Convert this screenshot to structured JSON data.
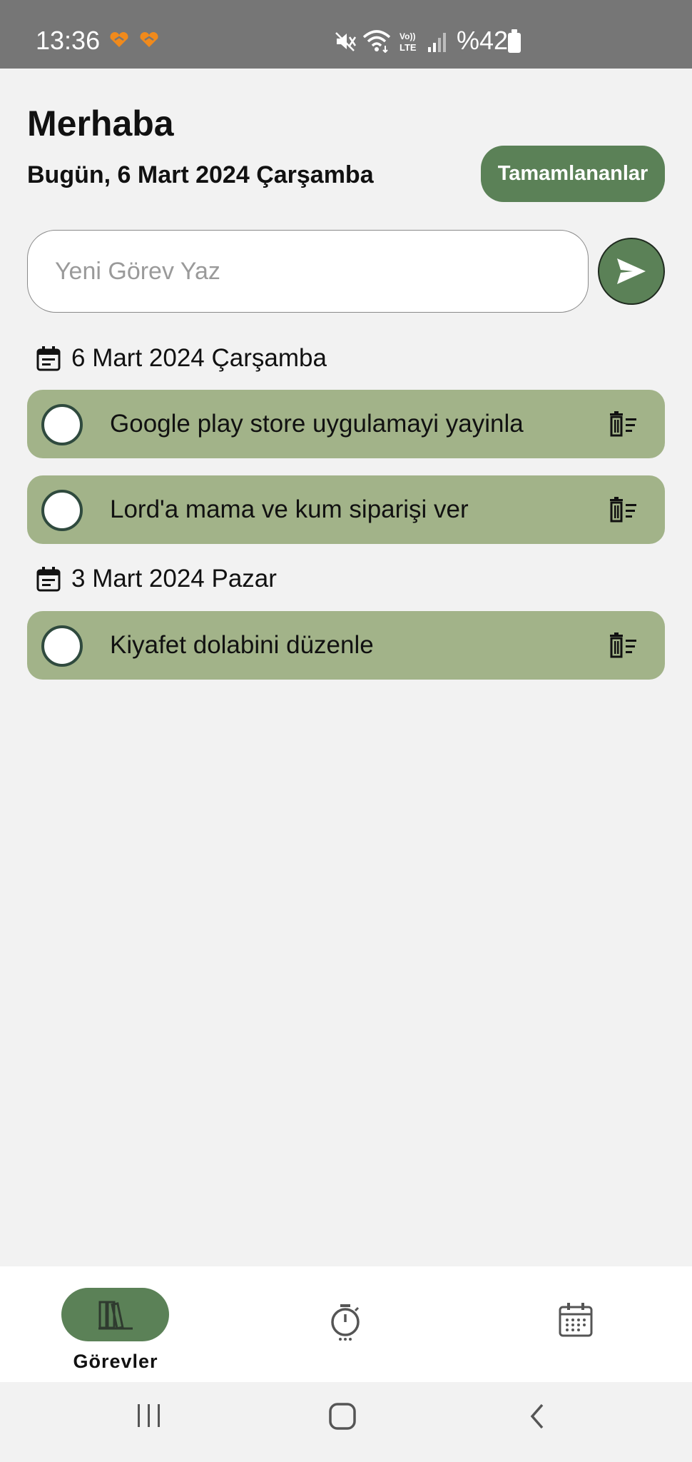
{
  "status_bar": {
    "time": "13:36",
    "battery_percent": "%42",
    "icons": [
      "heart-notification-icon",
      "heart-notification-icon",
      "mute-icon",
      "wifi-icon",
      "volte-icon",
      "signal-icon",
      "battery-icon"
    ]
  },
  "header": {
    "greeting": "Merhaba",
    "today": "Bugün, 6 Mart 2024 Çarşamba",
    "completed_button": "Tamamlananlar"
  },
  "new_task": {
    "placeholder": "Yeni Görev Yaz",
    "value": ""
  },
  "groups": [
    {
      "date": "6 Mart 2024 Çarşamba",
      "tasks": [
        {
          "title": "Google play store uygulamayi yayinla"
        },
        {
          "title": "Lord'a mama ve kum siparişi ver"
        }
      ]
    },
    {
      "date": "3 Mart 2024 Pazar",
      "tasks": [
        {
          "title": "Kiyafet dolabini düzenle"
        }
      ]
    }
  ],
  "bottom_nav": {
    "items": [
      {
        "label": "Görevler",
        "icon": "tasks-books-icon",
        "active": true
      },
      {
        "label": "",
        "icon": "timer-icon",
        "active": false
      },
      {
        "label": "",
        "icon": "calendar-icon",
        "active": false
      }
    ]
  },
  "colors": {
    "accent": "#5b8157",
    "task_bg": "#a2b389",
    "background": "#f2f2f2",
    "status_bar": "#767676"
  }
}
